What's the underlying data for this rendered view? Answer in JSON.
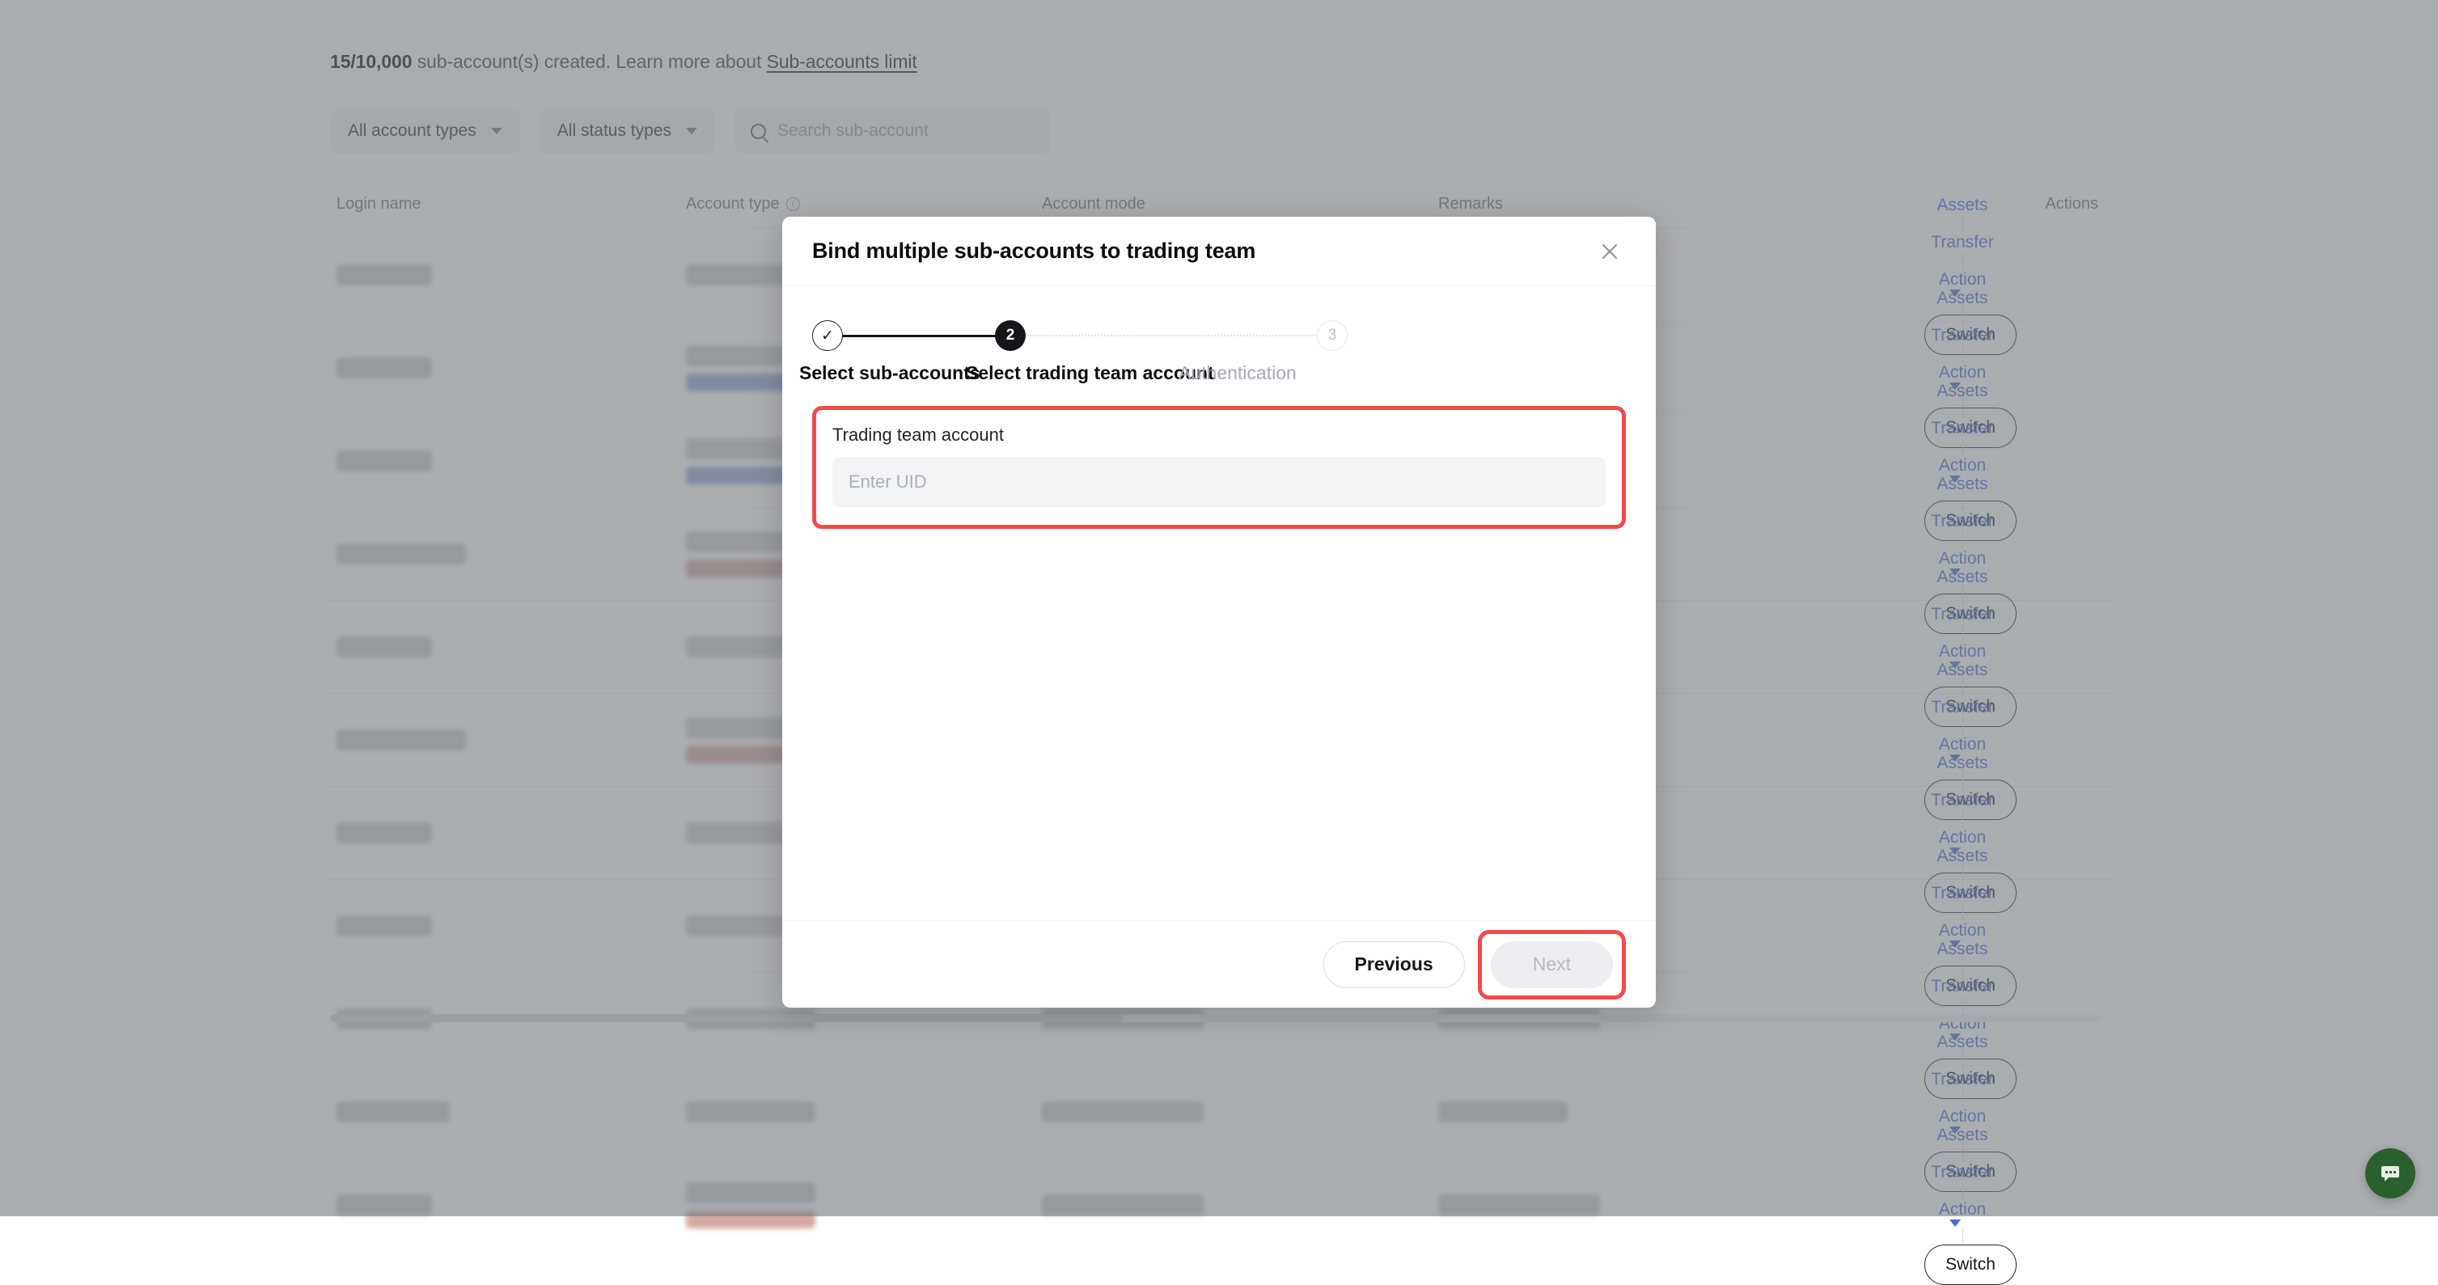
{
  "background": {
    "quota": {
      "count": "15/10,000",
      "text": " sub-account(s) created. Learn more about ",
      "link": "Sub-accounts limit"
    },
    "filters": {
      "account_type": "All account types",
      "status_type": "All status types",
      "search_placeholder": "Search sub-account",
      "search_value": ""
    },
    "table": {
      "headers": {
        "login_name": "Login name",
        "account_type": "Account type",
        "account_mode": "Account mode",
        "remarks": "Remarks",
        "actions": "Actions"
      },
      "row_actions": {
        "assets": "Assets",
        "transfer": "Transfer",
        "action": "Action",
        "switch": "Switch"
      },
      "row_count": 11
    }
  },
  "modal": {
    "title": "Bind multiple sub-accounts to trading team",
    "close_label": "×",
    "stepper": {
      "steps": [
        {
          "index": "1",
          "label": "Select sub-accounts",
          "state": "done",
          "marker": "✓"
        },
        {
          "index": "2",
          "label": "Select trading team account",
          "state": "active",
          "marker": "2"
        },
        {
          "index": "3",
          "label": "Authentication",
          "state": "todo",
          "marker": "3"
        }
      ]
    },
    "form": {
      "field_label": "Trading team account",
      "uid_placeholder": "Enter UID",
      "uid_value": ""
    },
    "footer": {
      "previous_label": "Previous",
      "next_label": "Next"
    }
  },
  "widgets": {
    "chat_label": "chat-bubble"
  },
  "colors": {
    "highlight": "#f04b4b",
    "accent_link": "#4a6cd4",
    "active_step": "#14171a",
    "chat_fab": "#2b5f2e"
  }
}
